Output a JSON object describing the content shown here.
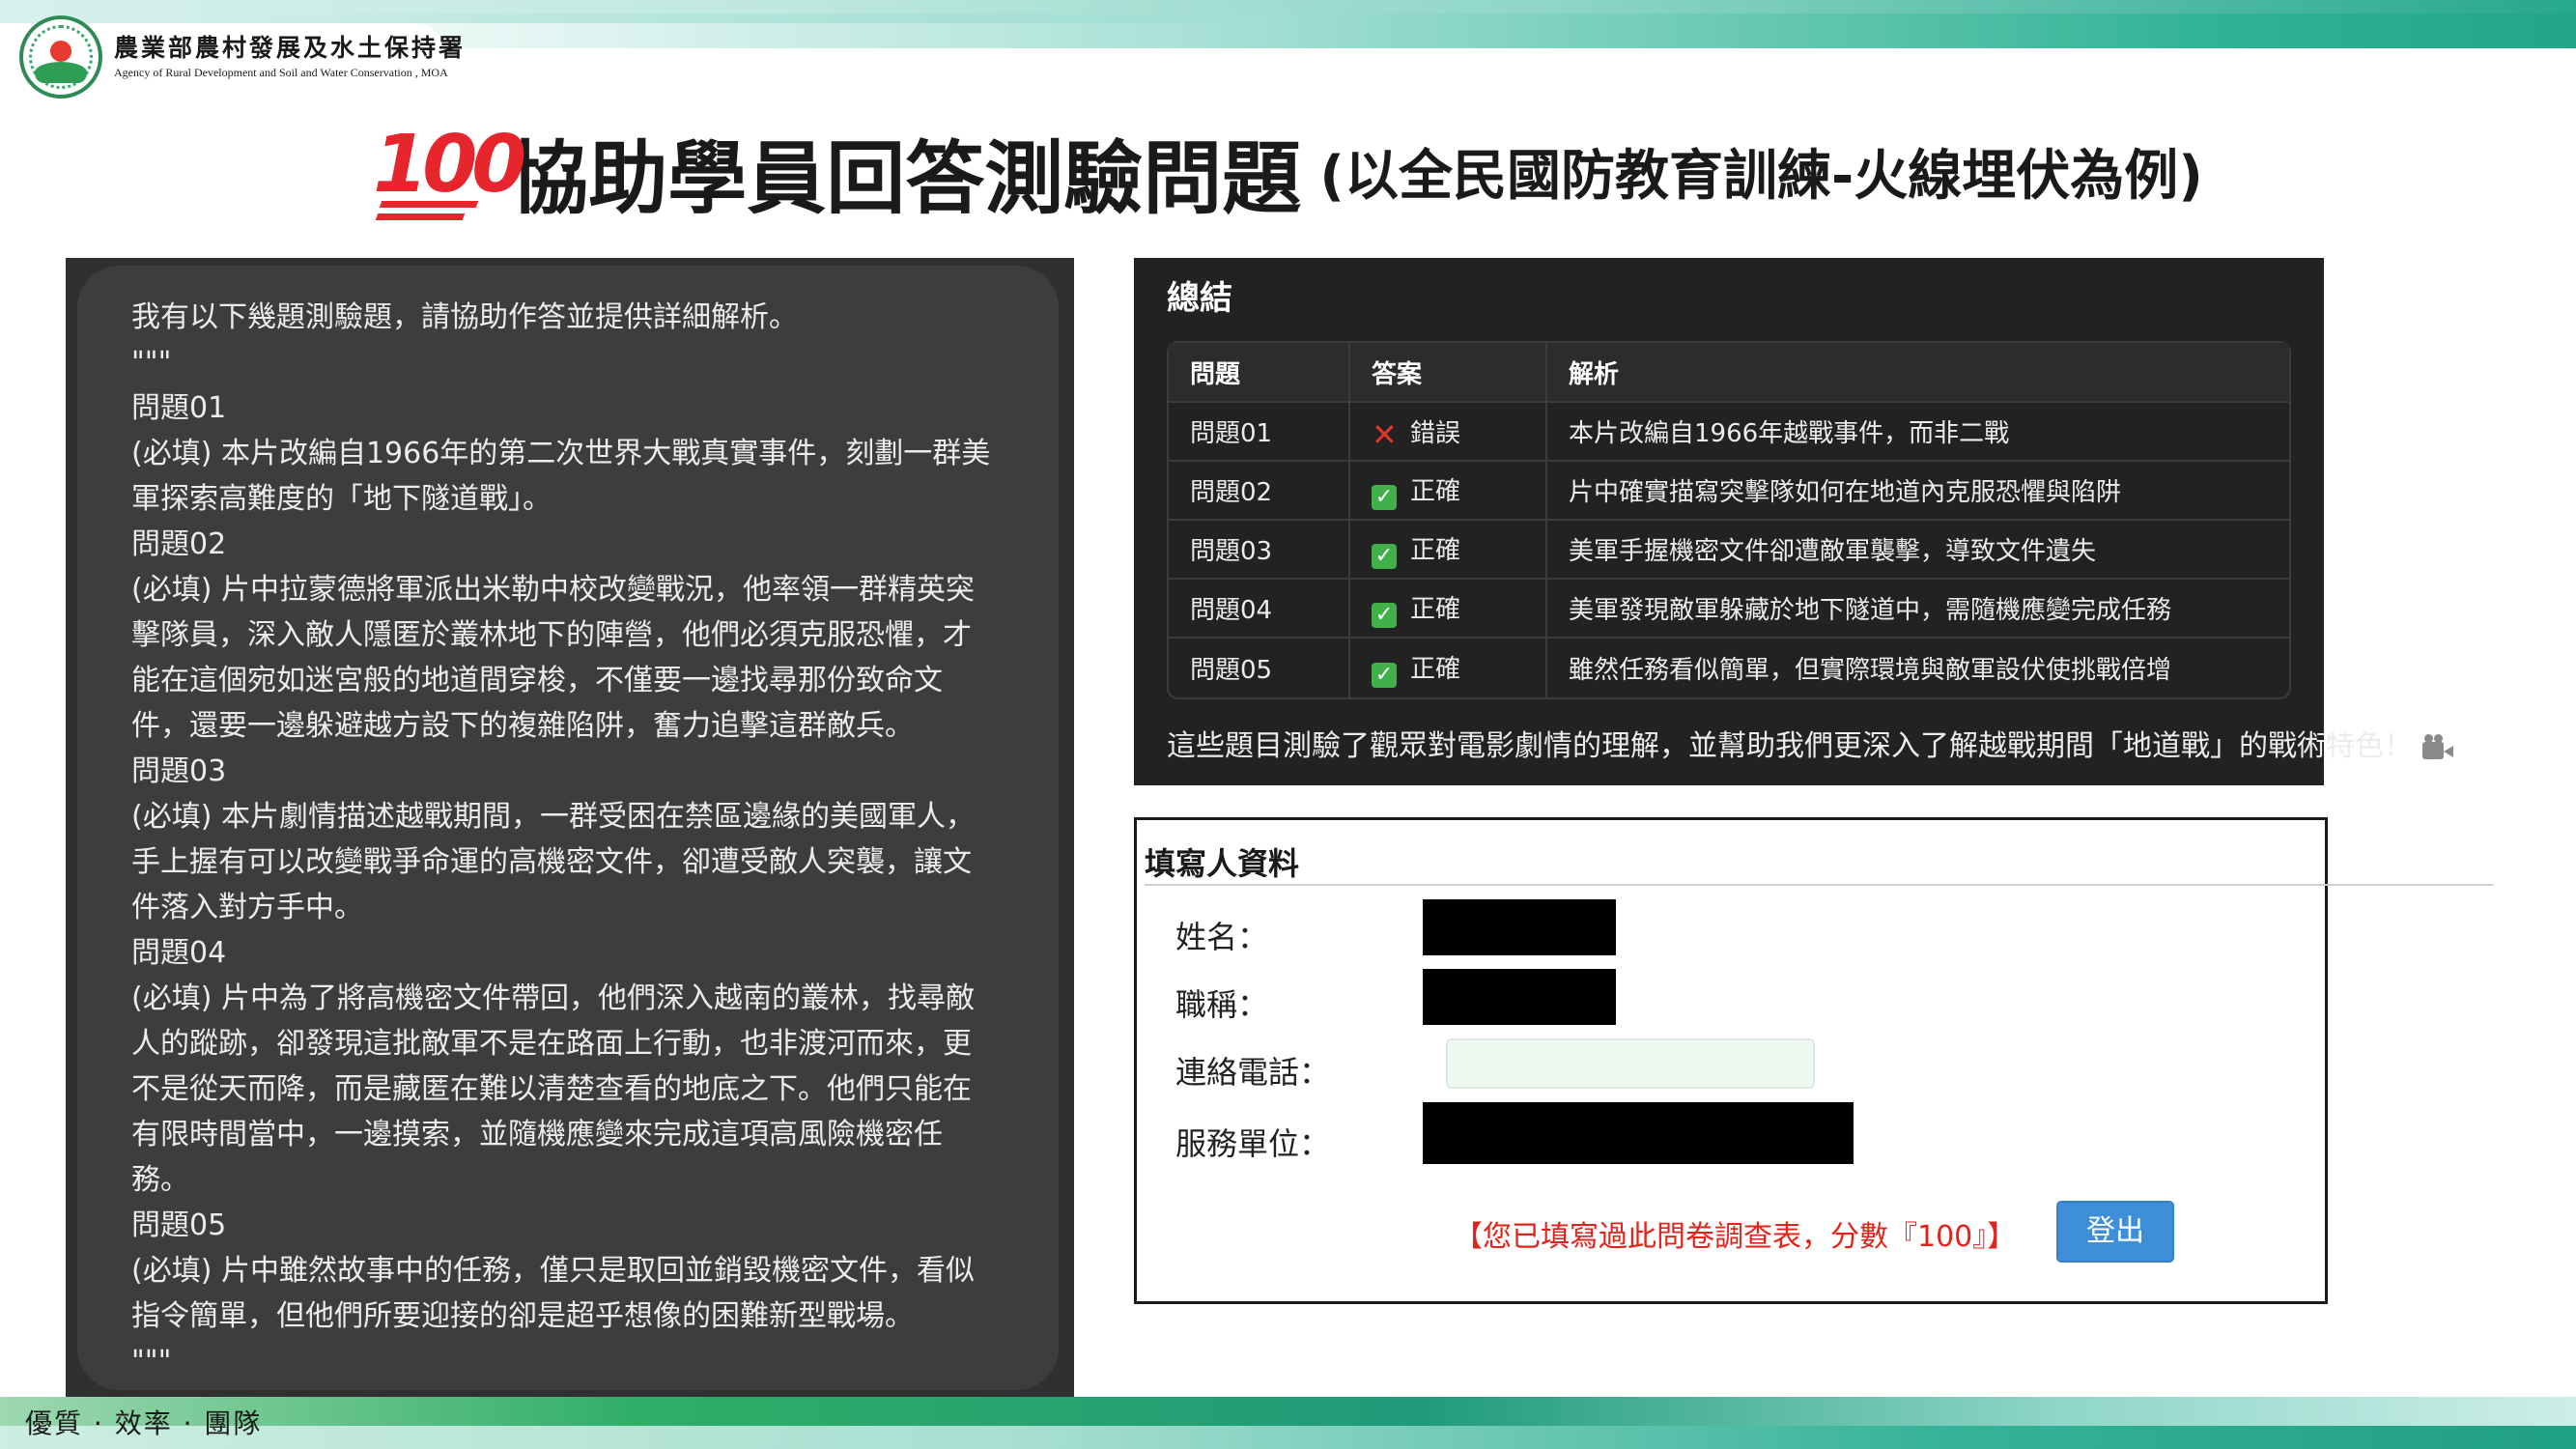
{
  "header": {
    "org_name": "農業部農村發展及水土保持署",
    "org_name_en": "Agency of Rural Development and Soil and Water Conservation , MOA",
    "logo_icon": "agency-seal-icon",
    "hundred_emoji": "100",
    "title_main": "協助學員回答測驗問題",
    "title_sub": "(以全民國防教育訓練-火線埋伏為例)"
  },
  "prompt": {
    "lines": [
      "我有以下幾題測驗題，請協助作答並提供詳細解析。",
      "\"\"\"",
      "問題01",
      "(必填) 本片改編自1966年的第二次世界大戰真實事件，刻劃一群美",
      "軍探索高難度的「地下隧道戰」。",
      "問題02",
      "(必填) 片中拉蒙德將軍派出米勒中校改變戰況，他率領一群精英突",
      "擊隊員，深入敵人隱匿於叢林地下的陣營，他們必須克服恐懼，才",
      "能在這個宛如迷宮般的地道間穿梭，不僅要一邊找尋那份致命文",
      "件，還要一邊躲避越方設下的複雜陷阱，奮力追擊這群敵兵。",
      "問題03",
      "(必填) 本片劇情描述越戰期間，一群受困在禁區邊緣的美國軍人，",
      "手上握有可以改變戰爭命運的高機密文件，卻遭受敵人突襲，讓文",
      "件落入對方手中。",
      "問題04",
      "(必填) 片中為了將高機密文件帶回，他們深入越南的叢林，找尋敵",
      "人的蹤跡，卻發現這批敵軍不是在路面上行動，也非渡河而來，更",
      "不是從天而降，而是藏匿在難以清楚查看的地底之下。他們只能在",
      "有限時間當中，一邊摸索，並隨機應變來完成這項高風險機密任",
      "務。",
      "問題05",
      "(必填) 片中雖然故事中的任務，僅只是取回並銷毀機密文件，看似",
      "指令簡單，但他們所要迎接的卻是超乎想像的困難新型戰場。",
      "\"\"\""
    ]
  },
  "summary": {
    "title": "總結",
    "headers": [
      "問題",
      "答案",
      "解析"
    ],
    "rows": [
      {
        "q": "問題01",
        "answer": "錯誤",
        "icon": "cross-mark-icon",
        "explanation": "本片改編自1966年越戰事件，而非二戰"
      },
      {
        "q": "問題02",
        "answer": "正確",
        "icon": "check-mark-icon",
        "explanation": "片中確實描寫突擊隊如何在地道內克服恐懼與陷阱"
      },
      {
        "q": "問題03",
        "answer": "正確",
        "icon": "check-mark-icon",
        "explanation": "美軍手握機密文件卻遭敵軍襲擊，導致文件遺失"
      },
      {
        "q": "問題04",
        "answer": "正確",
        "icon": "check-mark-icon",
        "explanation": "美軍發現敵軍躲藏於地下隧道中，需隨機應變完成任務"
      },
      {
        "q": "問題05",
        "answer": "正確",
        "icon": "check-mark-icon",
        "explanation": "雖然任務看似簡單，但實際環境與敵軍設伏使挑戰倍增"
      }
    ],
    "note": "這些題目測驗了觀眾對電影劇情的理解，並幫助我們更深入了解越戰期間「地道戰」的戰術特色！",
    "note_icon": "movie-camera-icon"
  },
  "form": {
    "title": "填寫人資料",
    "name_label": "姓名：",
    "title_label": "職稱：",
    "phone_label": "連絡電話：",
    "phone_value": "",
    "unit_label": "服務單位：",
    "status": "【您已填寫過此問卷調查表，分數『100』】",
    "logout_label": "登出"
  },
  "footer": {
    "tagline": "優質 · 效率 · 團隊"
  },
  "colors": {
    "accent_green": "#1f9f83",
    "dark_panel": "#303030",
    "status_red": "#e2231a",
    "button_blue": "#3f8fd8",
    "check_green": "#42b04a"
  }
}
